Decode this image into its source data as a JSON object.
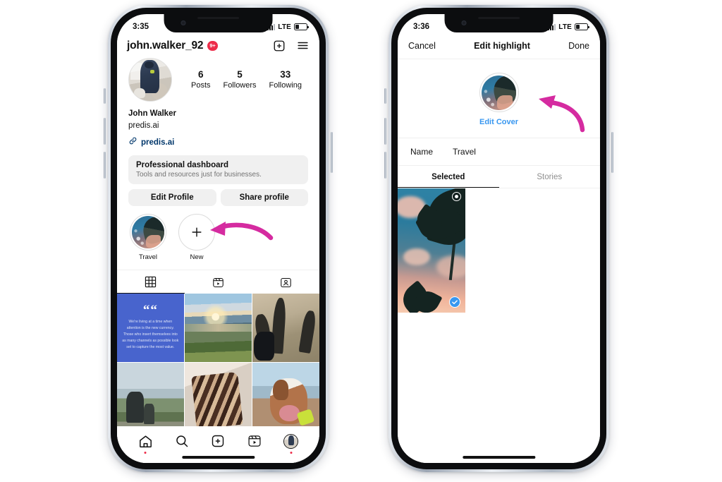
{
  "left_phone": {
    "status_bar": {
      "time": "3:35",
      "network": "LTE",
      "battery_level": "32%"
    },
    "header": {
      "username": "john.walker_92",
      "notification_badge": "9+",
      "add_icon": "plus-square-icon",
      "menu_icon": "hamburger-menu-icon"
    },
    "stats": [
      {
        "value": "6",
        "label": "Posts"
      },
      {
        "value": "5",
        "label": "Followers"
      },
      {
        "value": "33",
        "label": "Following"
      }
    ],
    "bio": {
      "display_name": "John Walker",
      "category": "predis.ai",
      "link": "predis.ai",
      "link_icon": "link-chain-icon"
    },
    "dashboard": {
      "title": "Professional dashboard",
      "subtitle": "Tools and resources just for businesses."
    },
    "actions": [
      "Edit Profile",
      "Share profile"
    ],
    "highlights": [
      {
        "label": "Travel",
        "type": "cover"
      },
      {
        "label": "New",
        "type": "add",
        "icon": "plus-icon"
      }
    ],
    "content_tabs": [
      {
        "icon": "grid-icon",
        "active": true
      },
      {
        "icon": "reels-icon",
        "active": false
      },
      {
        "icon": "tagged-icon",
        "active": false
      }
    ],
    "posts": [
      {
        "type": "quote",
        "quote_mark": "““",
        "text": "We're living at a time when attention is the new currency. Those who insert themselves into as many channels as possible look set to capture the most value.",
        "bg": "#4864CD"
      },
      {
        "type": "photo",
        "alt": "beach-sunset"
      },
      {
        "type": "photo",
        "alt": "shadows-with-dogs"
      },
      {
        "type": "photo",
        "alt": "mountain-motorbike"
      },
      {
        "type": "photo",
        "alt": "chocolate-cake-slice"
      },
      {
        "type": "photo",
        "alt": "bulldog-at-beach"
      }
    ],
    "tab_bar": [
      {
        "icon": "home-icon",
        "has_dot": true
      },
      {
        "icon": "search-icon",
        "has_dot": false
      },
      {
        "icon": "create-icon",
        "has_dot": false
      },
      {
        "icon": "reels-icon",
        "has_dot": false
      },
      {
        "icon": "profile-avatar-icon",
        "has_dot": true
      }
    ]
  },
  "right_phone": {
    "status_bar": {
      "time": "3:36",
      "network": "LTE",
      "battery_level": "32%"
    },
    "nav": {
      "cancel": "Cancel",
      "title": "Edit highlight",
      "done": "Done"
    },
    "cover": {
      "edit_cover_label": "Edit Cover",
      "link_color": "#3897F0"
    },
    "name_row": {
      "key": "Name",
      "value": "Travel"
    },
    "tabs": [
      {
        "label": "Selected",
        "active": true
      },
      {
        "label": "Stories",
        "active": false
      }
    ],
    "story_items": [
      {
        "alt": "palm-trees-sunset-sky",
        "selected": true,
        "eye_icon": "eye-badge-icon",
        "check_icon": "check-icon"
      }
    ]
  },
  "annotations": {
    "arrow_color": "#D52BA0",
    "arrows": [
      {
        "name": "arrow-to-new-highlight",
        "points_to": "New highlight button"
      },
      {
        "name": "arrow-to-edit-cover",
        "points_to": "Edit Cover thumbnail"
      }
    ]
  }
}
